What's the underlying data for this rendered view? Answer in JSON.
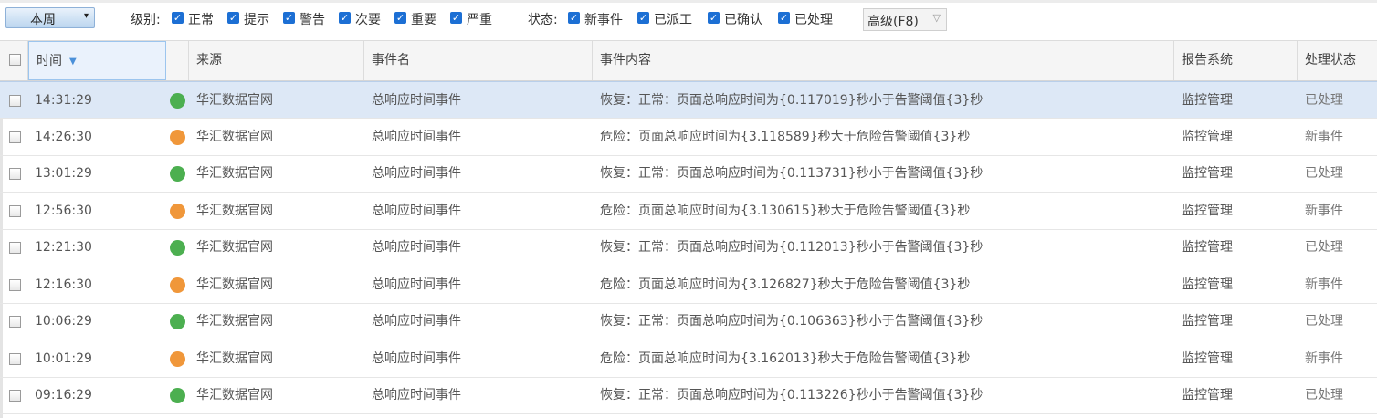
{
  "toolbar": {
    "period_label": "本周",
    "level_label": "级别:",
    "levels": [
      "正常",
      "提示",
      "警告",
      "次要",
      "重要",
      "严重"
    ],
    "status_label": "状态:",
    "statuses": [
      "新事件",
      "已派工",
      "已确认",
      "已处理"
    ],
    "advanced_label": "高级(F8)"
  },
  "icons": {
    "period_caret": "▾",
    "advanced_caret": "▽",
    "sort_arrow": "▼",
    "check": "✓"
  },
  "colors": {
    "recovered": "#4caf50",
    "danger": "#f0973a",
    "checkbox_blue": "#1c6fd4",
    "selected_row": "#dde8f6"
  },
  "table": {
    "columns": [
      "时间",
      "来源",
      "事件名",
      "事件内容",
      "报告系统",
      "处理状态"
    ],
    "rows": [
      {
        "time": "14:31:29",
        "level": "recovered",
        "source": "华汇数据官网",
        "name": "总响应时间事件",
        "content": "恢复：正常：页面总响应时间为{0.117019}秒小于告警阈值{3}秒",
        "system": "监控管理",
        "status": "已处理",
        "selected": true
      },
      {
        "time": "14:26:30",
        "level": "danger",
        "source": "华汇数据官网",
        "name": "总响应时间事件",
        "content": "危险：页面总响应时间为{3.118589}秒大于危险告警阈值{3}秒",
        "system": "监控管理",
        "status": "新事件"
      },
      {
        "time": "13:01:29",
        "level": "recovered",
        "source": "华汇数据官网",
        "name": "总响应时间事件",
        "content": "恢复：正常：页面总响应时间为{0.113731}秒小于告警阈值{3}秒",
        "system": "监控管理",
        "status": "已处理"
      },
      {
        "time": "12:56:30",
        "level": "danger",
        "source": "华汇数据官网",
        "name": "总响应时间事件",
        "content": "危险：页面总响应时间为{3.130615}秒大于危险告警阈值{3}秒",
        "system": "监控管理",
        "status": "新事件"
      },
      {
        "time": "12:21:30",
        "level": "recovered",
        "source": "华汇数据官网",
        "name": "总响应时间事件",
        "content": "恢复：正常：页面总响应时间为{0.112013}秒小于告警阈值{3}秒",
        "system": "监控管理",
        "status": "已处理"
      },
      {
        "time": "12:16:30",
        "level": "danger",
        "source": "华汇数据官网",
        "name": "总响应时间事件",
        "content": "危险：页面总响应时间为{3.126827}秒大于危险告警阈值{3}秒",
        "system": "监控管理",
        "status": "新事件"
      },
      {
        "time": "10:06:29",
        "level": "recovered",
        "source": "华汇数据官网",
        "name": "总响应时间事件",
        "content": "恢复：正常：页面总响应时间为{0.106363}秒小于告警阈值{3}秒",
        "system": "监控管理",
        "status": "已处理"
      },
      {
        "time": "10:01:29",
        "level": "danger",
        "source": "华汇数据官网",
        "name": "总响应时间事件",
        "content": "危险：页面总响应时间为{3.162013}秒大于危险告警阈值{3}秒",
        "system": "监控管理",
        "status": "新事件"
      },
      {
        "time": "09:16:29",
        "level": "recovered",
        "source": "华汇数据官网",
        "name": "总响应时间事件",
        "content": "恢复：正常：页面总响应时间为{0.113226}秒小于告警阈值{3}秒",
        "system": "监控管理",
        "status": "已处理"
      }
    ]
  }
}
